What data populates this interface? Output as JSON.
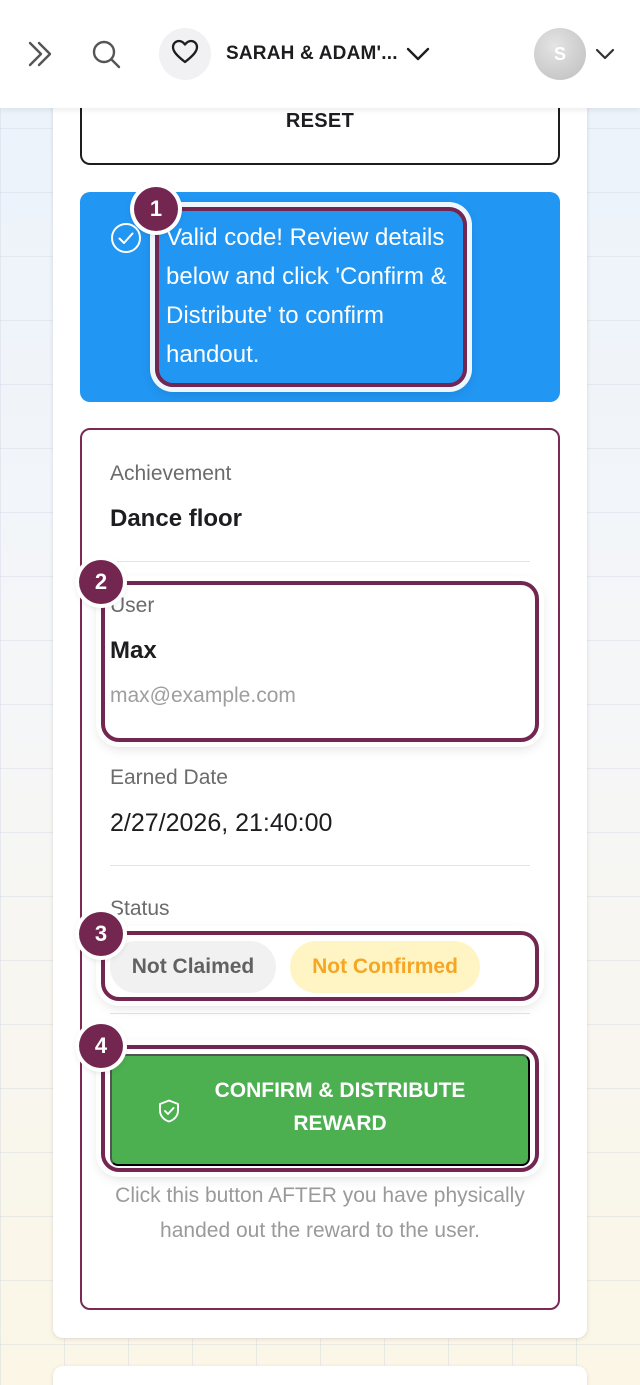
{
  "topbar": {
    "event_name": "SARAH & ADAM'...",
    "avatar_initial": "S",
    "icons": [
      "double-chevron-right-icon",
      "search-icon",
      "heart-icon",
      "chevron-down-icon",
      "chevron-down-icon"
    ]
  },
  "reset": {
    "label": "RESET"
  },
  "alert": {
    "icon": "check-circle-icon",
    "message": "Valid code! Review details below and click 'Confirm & Distribute' to confirm handout."
  },
  "details": {
    "achievement_label": "Achievement",
    "achievement_value": "Dance floor",
    "user_label": "User",
    "user_name": "Max",
    "user_email": "max@example.com",
    "earned_label": "Earned Date",
    "earned_value": "2/27/2026, 21:40:00",
    "status_label": "Status",
    "status_claim": "Not Claimed",
    "status_confirm": "Not Confirmed"
  },
  "confirm": {
    "icon": "shield-check-icon",
    "label": "CONFIRM & DISTRIBUTE\nREWARD",
    "helper": "Click this button AFTER you have physically handed out the reward to the user."
  },
  "tutorial": {
    "steps": [
      "1",
      "2",
      "3",
      "4"
    ]
  },
  "colors": {
    "accent_blue": "#2196f3",
    "success_green": "#4caf50",
    "highlight": "#732650",
    "warning_text": "#f5a623",
    "warning_bg": "#fff5c4"
  }
}
